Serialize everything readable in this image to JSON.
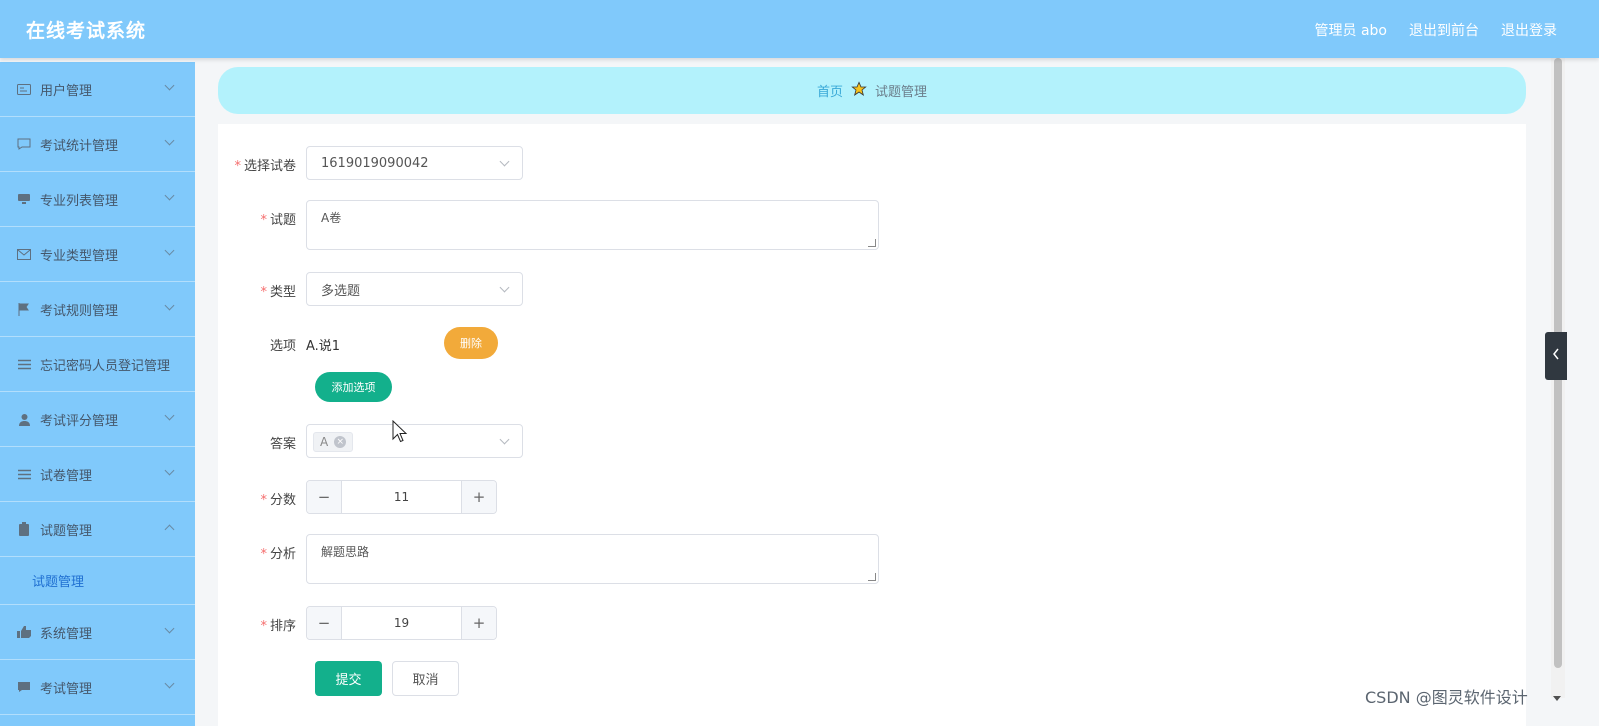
{
  "header": {
    "title": "在线考试系统",
    "links": [
      "管理员 abo",
      "退出到前台",
      "退出登录"
    ]
  },
  "sidebar": {
    "items": [
      {
        "label": "用户管理",
        "icon": "id-card-icon"
      },
      {
        "label": "考试统计管理",
        "icon": "chat-icon"
      },
      {
        "label": "专业列表管理",
        "icon": "monitor-icon"
      },
      {
        "label": "专业类型管理",
        "icon": "mail-icon"
      },
      {
        "label": "考试规则管理",
        "icon": "flag-icon"
      },
      {
        "label": "忘记密码人员登记管理",
        "icon": "list-icon"
      },
      {
        "label": "考试评分管理",
        "icon": "user-icon"
      },
      {
        "label": "试卷管理",
        "icon": "list-icon"
      },
      {
        "label": "试题管理",
        "icon": "clipboard-icon"
      },
      {
        "label": "系统管理",
        "icon": "thumb-icon"
      },
      {
        "label": "考试管理",
        "icon": "chat-bubble-icon"
      }
    ],
    "sub_item": "试题管理"
  },
  "breadcrumb": {
    "home": "首页",
    "current": "试题管理"
  },
  "form": {
    "paper_label": "选择试卷",
    "paper_value": "1619019090042",
    "question_label": "试题",
    "question_value": "A卷",
    "type_label": "类型",
    "type_value": "多选题",
    "options_label": "选项",
    "option_text": "A.说1",
    "delete_label": "删除",
    "add_option_label": "添加选项",
    "answer_label": "答案",
    "answer_tag": "A",
    "score_label": "分数",
    "score_value": "11",
    "analysis_label": "分析",
    "analysis_value": "解题思路",
    "order_label": "排序",
    "order_value": "19",
    "minus": "−",
    "plus": "+",
    "submit_label": "提交",
    "cancel_label": "取消"
  },
  "watermark": "CSDN @图灵软件设计",
  "colors": {
    "header": "#80c9fb",
    "breadcrumb": "#b3f2fc",
    "primary": "#13b08c",
    "warning": "#f2aa3a"
  }
}
